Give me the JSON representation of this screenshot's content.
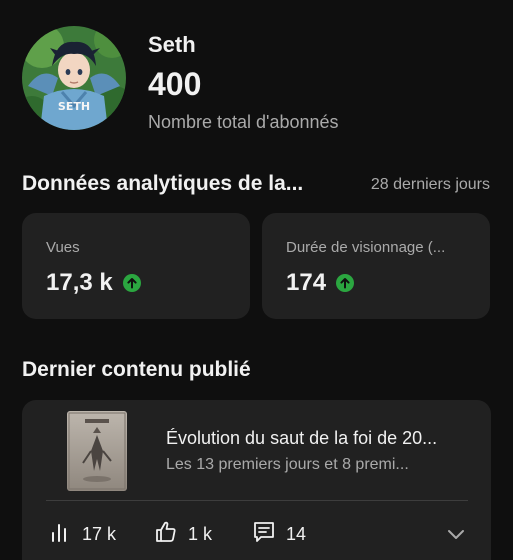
{
  "profile": {
    "channel_name": "Seth",
    "subscriber_count": "400",
    "subscriber_label": "Nombre total d'abonnés",
    "avatar_shirt_text": "SETH"
  },
  "analytics": {
    "title": "Données analytiques de la...",
    "period": "28 derniers jours",
    "cards": {
      "views": {
        "label": "Vues",
        "value": "17,3 k",
        "trend_icon": "arrow-up-circle-icon"
      },
      "watch_time": {
        "label": "Durée de visionnage (...",
        "value": "174",
        "trend_icon": "arrow-up-circle-icon"
      }
    },
    "trend_color": "#2ba640"
  },
  "latest_content": {
    "section_title": "Dernier contenu publié",
    "video": {
      "title": "Évolution du saut de la foi de 20...",
      "subtitle": "Les 13 premiers jours et 8 premi...",
      "views": "17 k",
      "likes": "1 k",
      "comments": "14"
    }
  },
  "colors": {
    "background": "#0f0f0f",
    "card": "#212121",
    "text_primary": "#f1f1f1",
    "text_secondary": "#aaaaaa"
  }
}
